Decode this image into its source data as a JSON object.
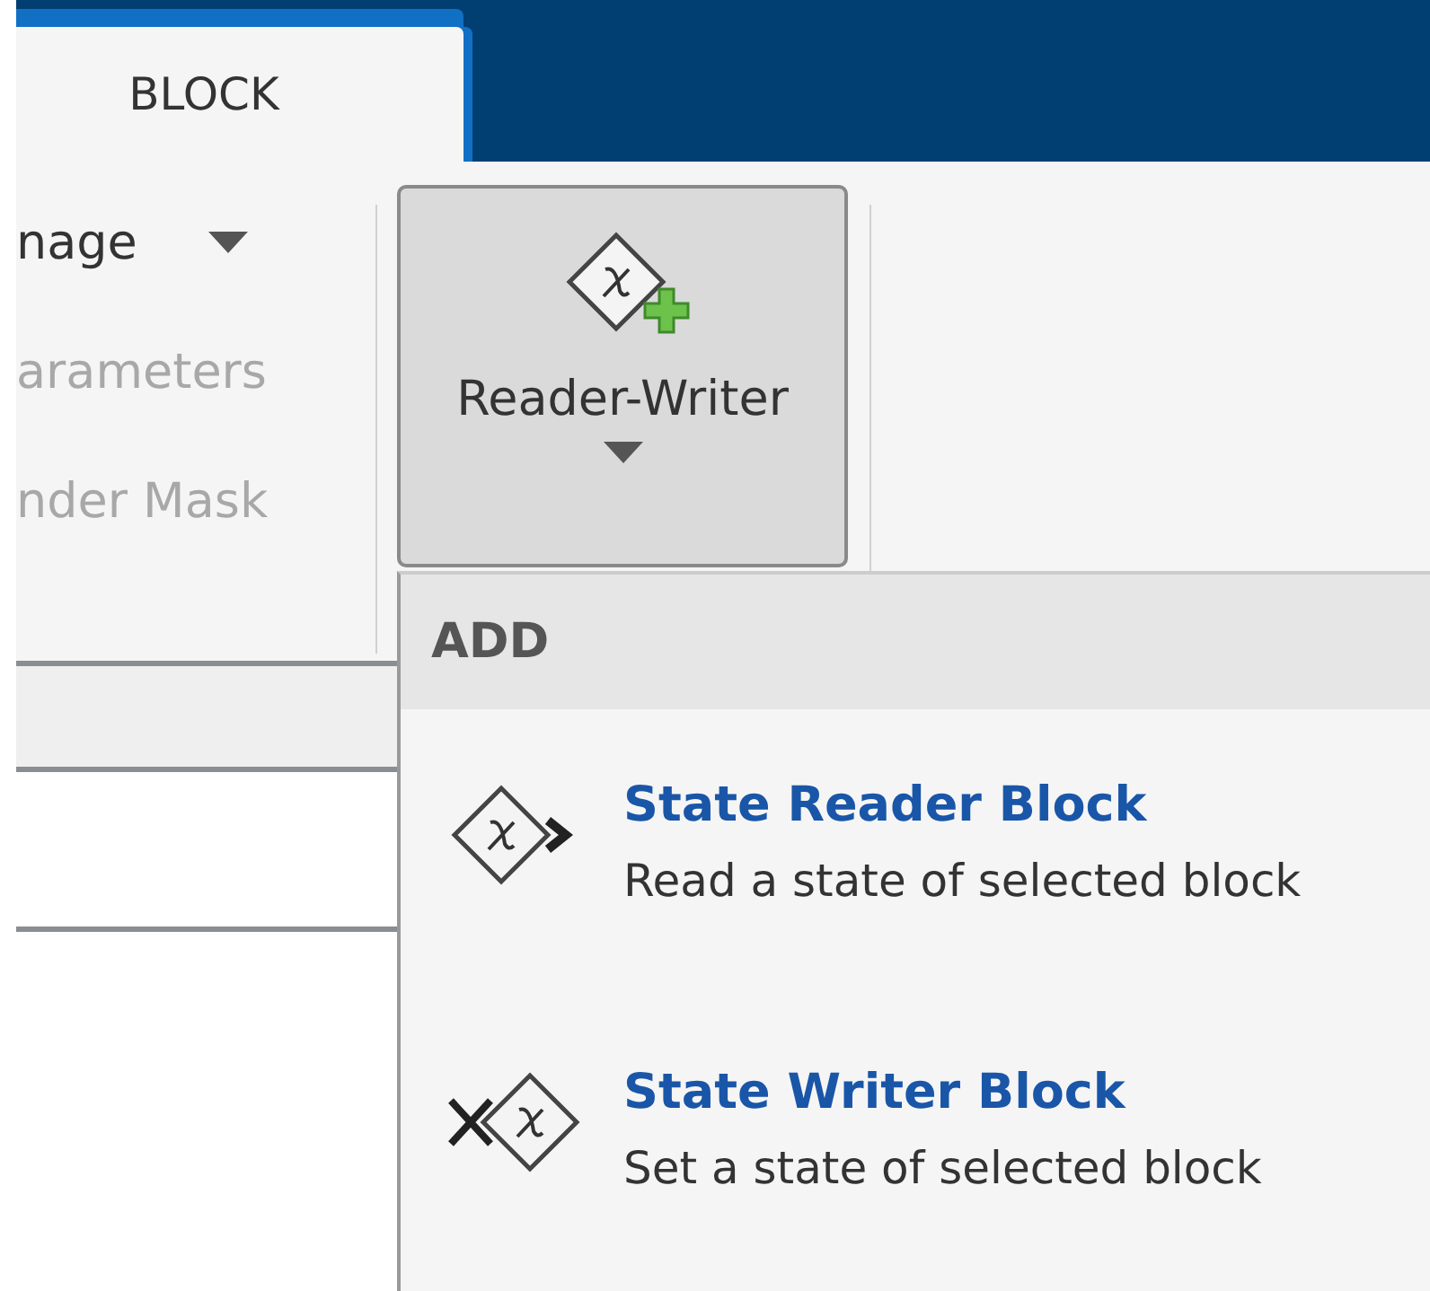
{
  "tabs": [
    {
      "label": "BLOCK",
      "selected": true
    }
  ],
  "ribbon": {
    "left_group": [
      {
        "label": "nage",
        "kind": "dropdown",
        "disabled": false
      },
      {
        "label": "arameters",
        "kind": "button",
        "disabled": true
      },
      {
        "label": "nder Mask",
        "kind": "button",
        "disabled": true
      }
    ],
    "reader_writer_button": {
      "label": "Reader-Writer",
      "expanded": true
    }
  },
  "menu": {
    "header": "ADD",
    "items": [
      {
        "kind": "reader",
        "title": "State Reader Block",
        "description": "Read a state of selected block"
      },
      {
        "kind": "writer",
        "title": "State Writer Block",
        "description": "Set a state of selected block"
      }
    ]
  }
}
